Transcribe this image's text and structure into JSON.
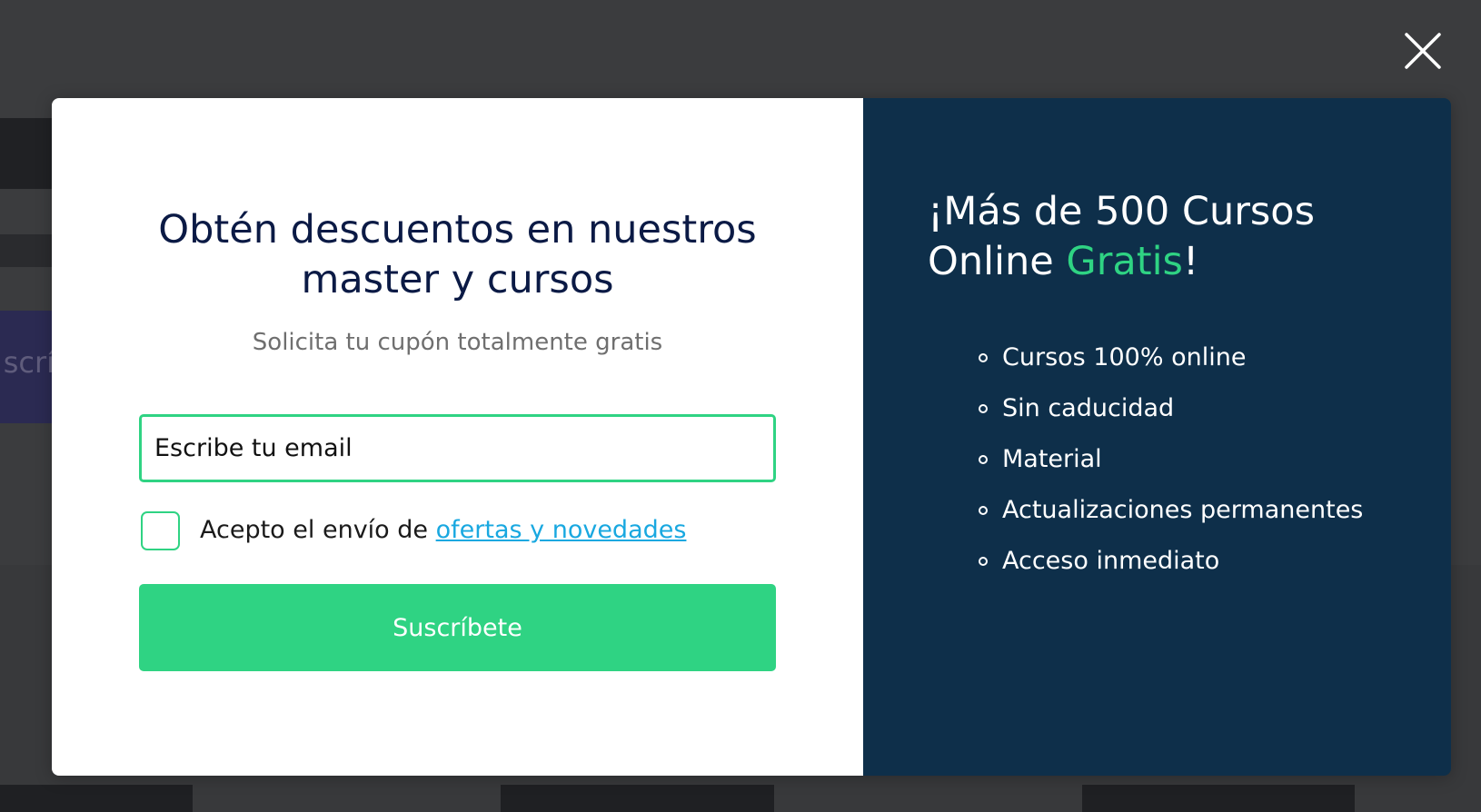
{
  "background": {
    "button_fragment_text": "scrí"
  },
  "popup": {
    "close_icon": "close-icon",
    "form": {
      "title": "Obtén descuentos en nuestros master y cursos",
      "subtitle": "Solicita tu cupón totalmente gratis",
      "email_placeholder": "Escribe tu email",
      "email_value": "",
      "consent_prefix": "Acepto el envío de ",
      "consent_link": "ofertas y novedades",
      "consent_checked": false,
      "submit_label": "Suscríbete"
    },
    "promo": {
      "title_part1": "¡Más de 500 Cursos Online ",
      "title_accent": "Gratis",
      "title_part2": "!",
      "features": [
        "Cursos 100% online",
        "Sin caducidad",
        "Material",
        "Actualizaciones permanentes",
        "Acceso inmediato"
      ]
    }
  },
  "colors": {
    "accent_green": "#2fd383",
    "panel_navy": "#0e2f4a",
    "title_navy": "#0b1a45",
    "link_blue": "#19a8e0",
    "overlay": "#3b3c3e"
  }
}
